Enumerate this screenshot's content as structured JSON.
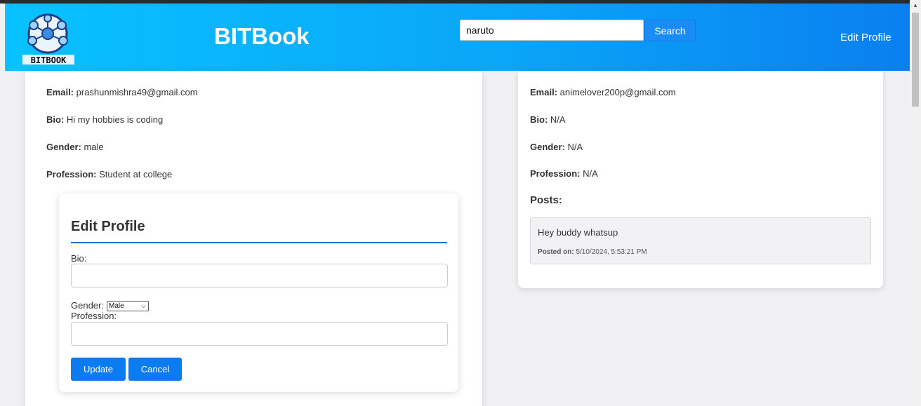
{
  "header": {
    "brand": "BITBook",
    "logo_text": "BITBOOK",
    "search": {
      "value": "naruto",
      "button": "Search"
    },
    "edit_profile_link": "Edit Profile"
  },
  "left_profile": {
    "email_label": "Email:",
    "email": "prashunmishra49@gmail.com",
    "bio_label": "Bio:",
    "bio": "Hi my hobbies is coding",
    "gender_label": "Gender:",
    "gender": "male",
    "profession_label": "Profession:",
    "profession": "Student at college"
  },
  "edit_form": {
    "title": "Edit Profile",
    "bio_label": "Bio:",
    "gender_label": "Gender:",
    "gender_selected": "Male",
    "profession_label": "Profession:",
    "update_button": "Update",
    "cancel_button": "Cancel"
  },
  "right_profile": {
    "email_label": "Email:",
    "email": "animelover200p@gmail.com",
    "bio_label": "Bio:",
    "bio": "N/A",
    "gender_label": "Gender:",
    "gender": "N/A",
    "profession_label": "Profession:",
    "profession": "N/A",
    "posts_heading": "Posts:",
    "posts": [
      {
        "text": "Hey buddy whatsup",
        "posted_label": "Posted on:",
        "posted_on": "5/10/2024, 5:53:21 PM"
      }
    ]
  },
  "colors": {
    "header_start": "#08c2ff",
    "header_end": "#0a7ff0",
    "accent": "#0b7bf0"
  }
}
